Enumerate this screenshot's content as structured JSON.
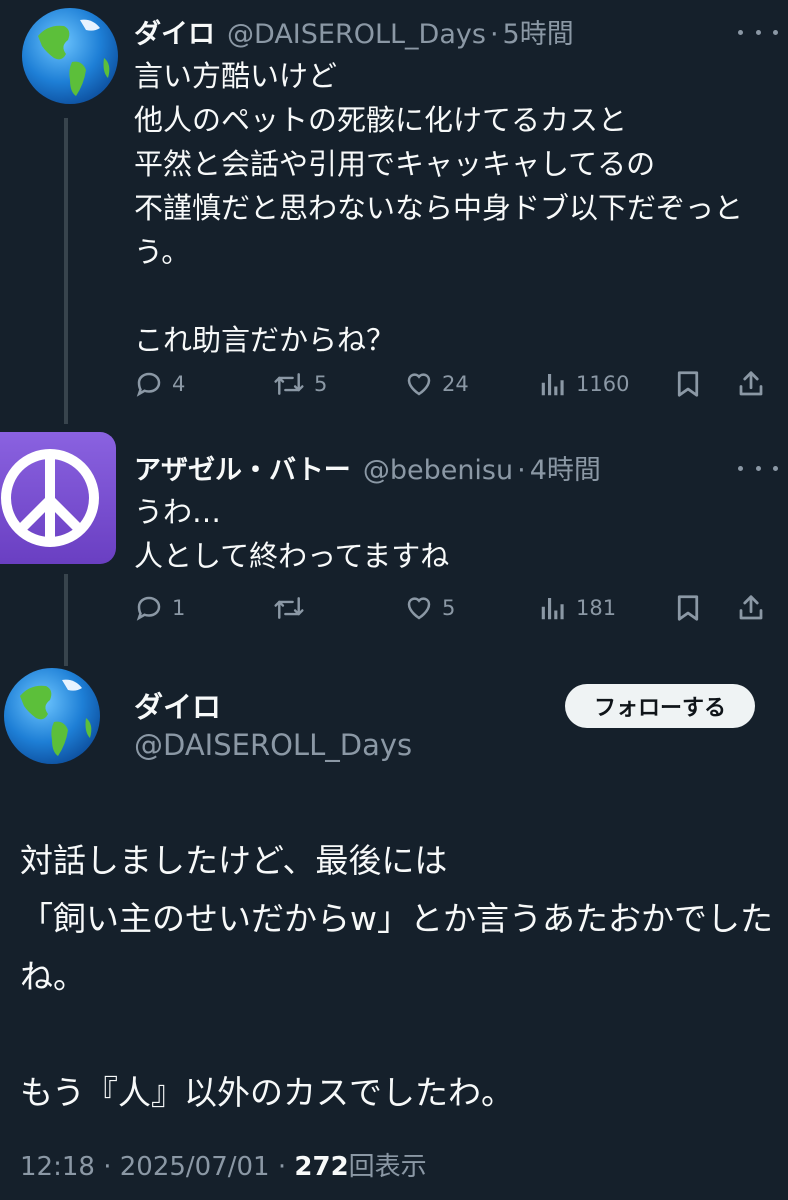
{
  "tweets": [
    {
      "name": "ダイロ",
      "handle": "@DAISEROLL_Days",
      "separator": "·",
      "time": "5時間",
      "text": "言い方酷いけど\n他人のペットの死骸に化けてるカスと\n平然と会話や引用でキャッキャしてるの\n不謹慎だと思わないなら中身ドブ以下だぞっとう。\n\nこれ助言だからね？",
      "replies": "4",
      "reposts": "5",
      "likes": "24",
      "views": "1160"
    },
    {
      "name": "アザゼル・バトー",
      "handle": "@bebenisu",
      "separator": "·",
      "time": "4時間",
      "text": "うわ…\n人として終わってますね",
      "replies": "1",
      "reposts": "",
      "likes": "5",
      "views": "181"
    }
  ],
  "main": {
    "name": "ダイロ",
    "handle": "@DAISEROLL_Days",
    "follow_label": "フォローする",
    "text": "対話しましたけど、最後には\n「飼い主のせいだからw」とか言うあたおかでしたね。\n\nもう『人』以外のカスでしたわ。",
    "time": "12:18",
    "sep1": " · ",
    "date": "2025/07/01",
    "sep2": " · ",
    "views": "272",
    "views_label": "回表示"
  },
  "icons": {
    "avatar_daisero": "globe-americas-emoji",
    "avatar_bebenisu": "peace-symbol-emoji",
    "reply": "reply-icon",
    "repost": "repost-icon",
    "like": "heart-icon",
    "views": "views-icon",
    "bookmark": "bookmark-icon",
    "share": "share-icon",
    "more": "more-icon"
  },
  "colors": {
    "background": "#15202b",
    "text": "#f7f9f9",
    "muted": "#8b98a5",
    "peace_purple": "#7a4fd0"
  }
}
